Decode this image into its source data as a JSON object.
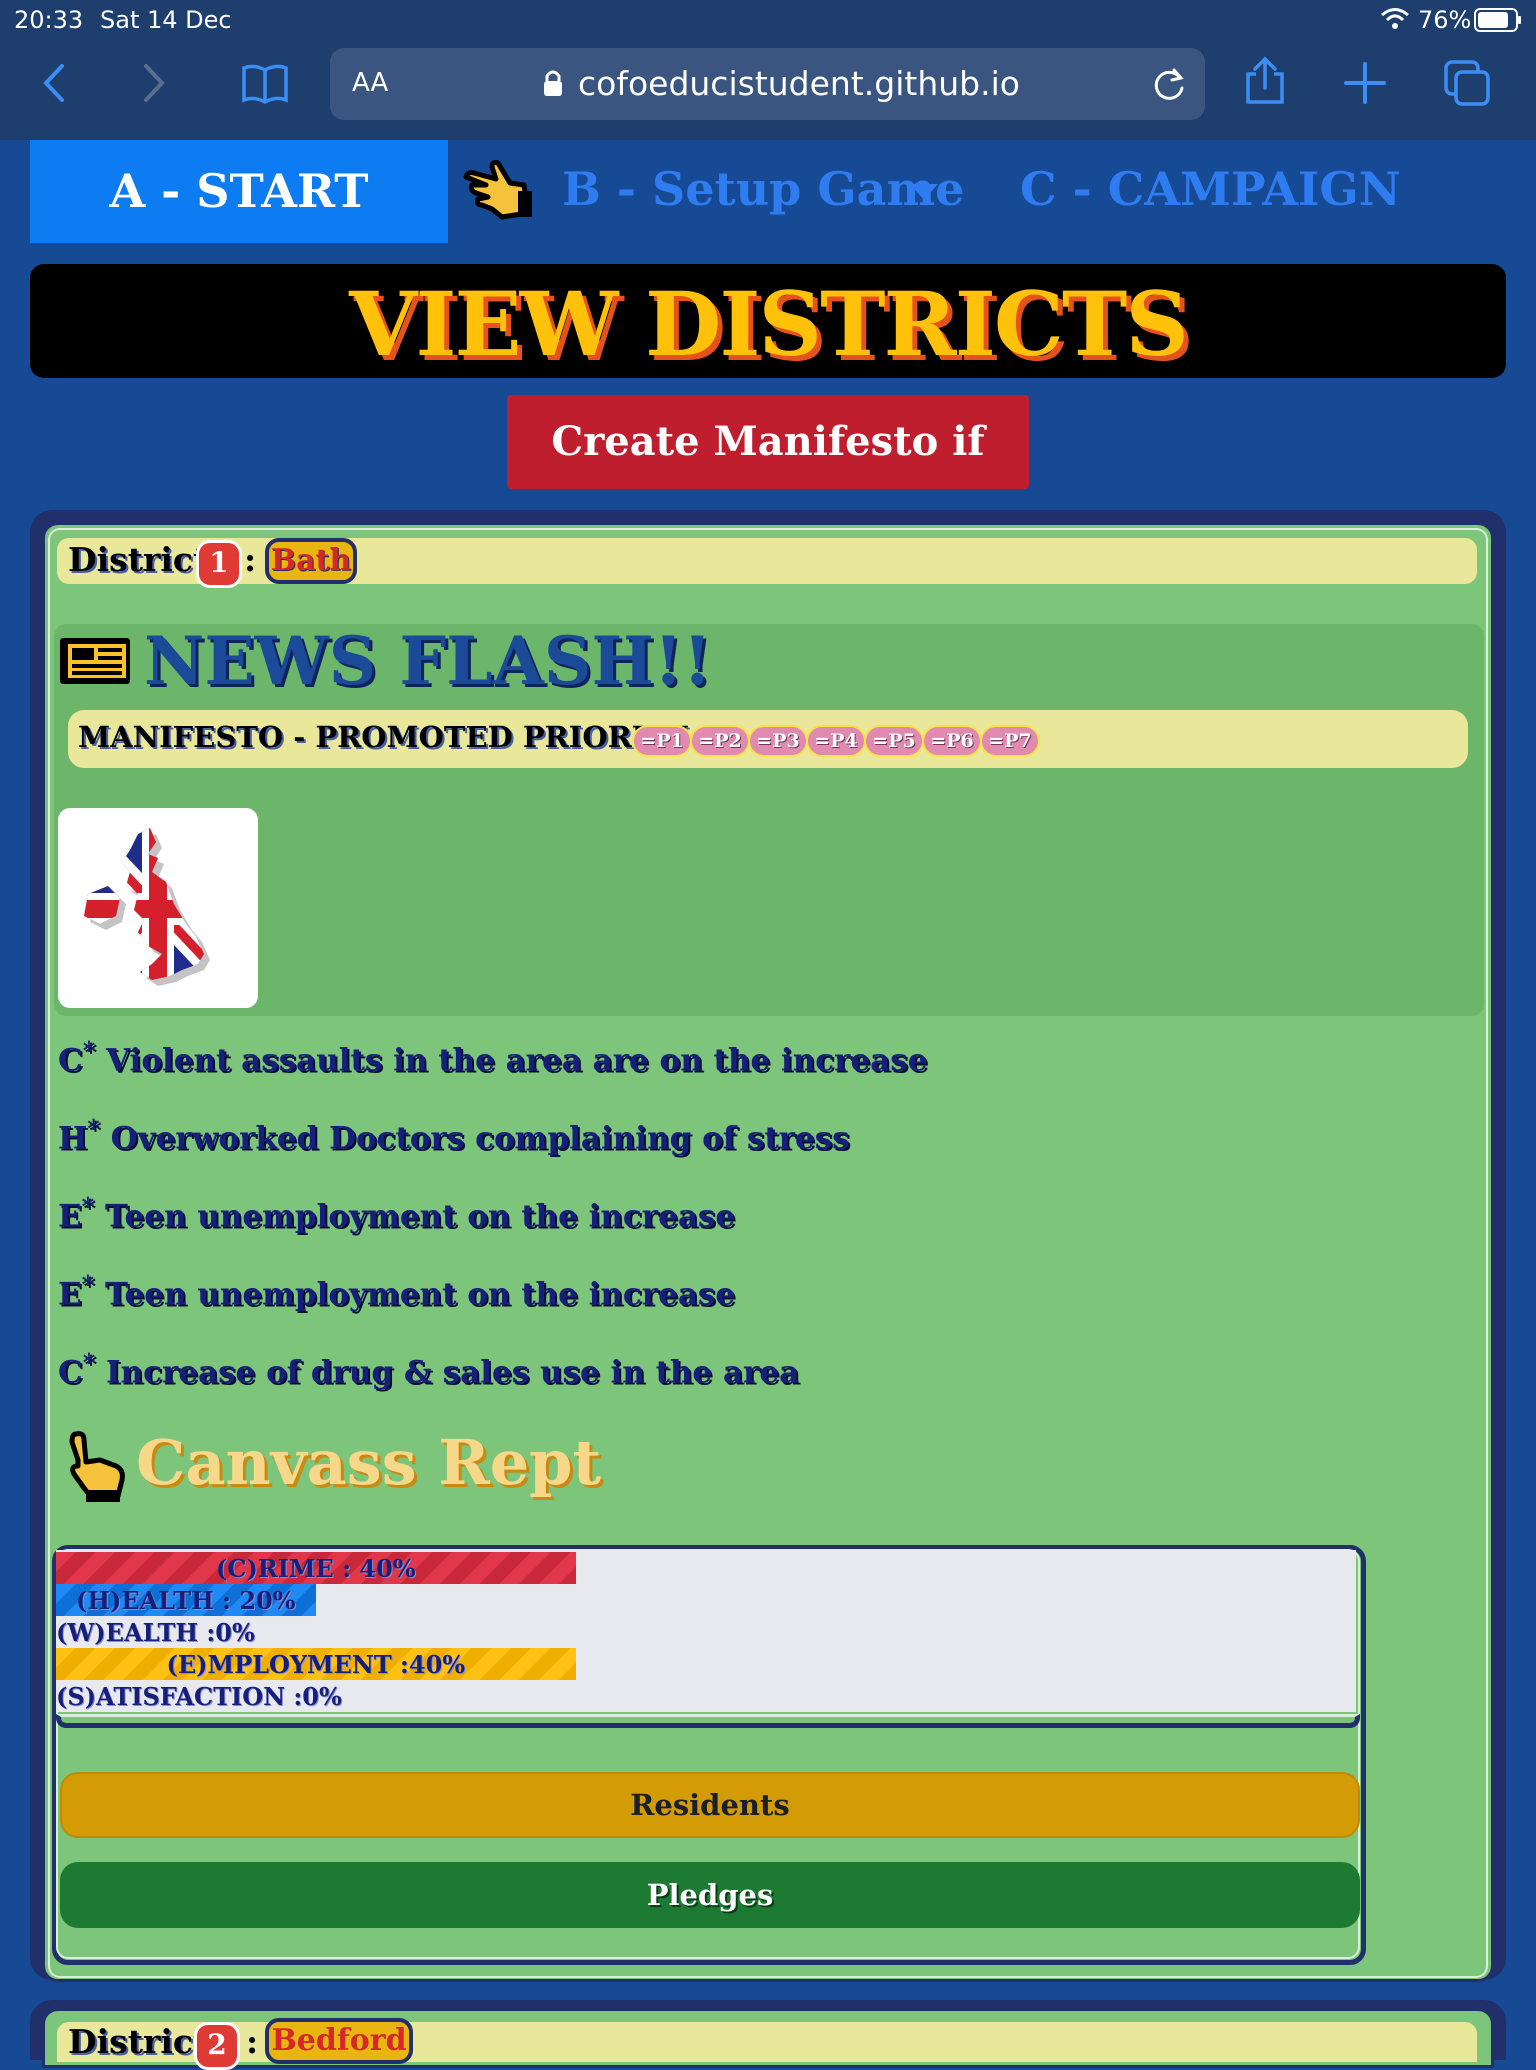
{
  "status_bar": {
    "time": "20:33",
    "date": "Sat 14 Dec",
    "battery": "76%"
  },
  "browser": {
    "text_size": "AA",
    "url": "cofoeducistudent.github.io"
  },
  "nav": {
    "tab_a": "A - START HERE",
    "tab_b": "B - Setup Game",
    "tab_c": "C - CAMPAIGN"
  },
  "page": {
    "title": "VIEW DISTRICTS",
    "manifesto_button": "Create Manifesto if ready"
  },
  "district": {
    "label": "District:",
    "number": "1",
    "separator": ":",
    "name": "Bath",
    "news_title": "NEWS FLASH!!",
    "priority_label": "MANIFESTO - PROMOTED PRIORITY :",
    "priorities": [
      "=P1",
      "=P2",
      "=P3",
      "=P4",
      "=P5",
      "=P6",
      "=P7"
    ],
    "issues": [
      {
        "code": "C",
        "mark": "*",
        "text": "Violent assaults in the area are on the increase"
      },
      {
        "code": "H",
        "mark": "*",
        "text": "Overworked Doctors complaining of stress"
      },
      {
        "code": "E",
        "mark": "*",
        "text": "Teen unemployment on the increase"
      },
      {
        "code": "E",
        "mark": "*",
        "text": "Teen unemployment on the increase"
      },
      {
        "code": "C",
        "mark": "*",
        "text": "Increase of drug & sales use in the area"
      }
    ],
    "canvass_title": "Canvass Rept",
    "canvass": [
      {
        "label": "(C)RIME : 40%",
        "value": 40
      },
      {
        "label": "(H)EALTH : 20%",
        "value": 20
      },
      {
        "label": "(W)EALTH :0%",
        "value": 0
      },
      {
        "label": "(E)MPLOYMENT :40%",
        "value": 40
      },
      {
        "label": "(S)ATISFACTION :0%",
        "value": 0
      }
    ],
    "residents_button": "Residents",
    "pledges_button": "Pledges"
  },
  "next_district": {
    "label": "District:",
    "number": "2",
    "separator": ":",
    "name": "Bedford"
  },
  "colors": {
    "page_bg": "#164a94",
    "card_bg": "#7dc57a",
    "crime": "#e0374a",
    "health": "#1e8af5",
    "employment": "#ffc113",
    "residents": "#d39b05",
    "pledges": "#1c7a32"
  },
  "icons": [
    "back-icon",
    "forward-icon",
    "bookmarks-icon",
    "lock-icon",
    "reload-icon",
    "share-icon",
    "new-tab-icon",
    "tabs-icon",
    "pointing-hand-icon",
    "newspaper-icon",
    "uk-flag-map-icon"
  ]
}
